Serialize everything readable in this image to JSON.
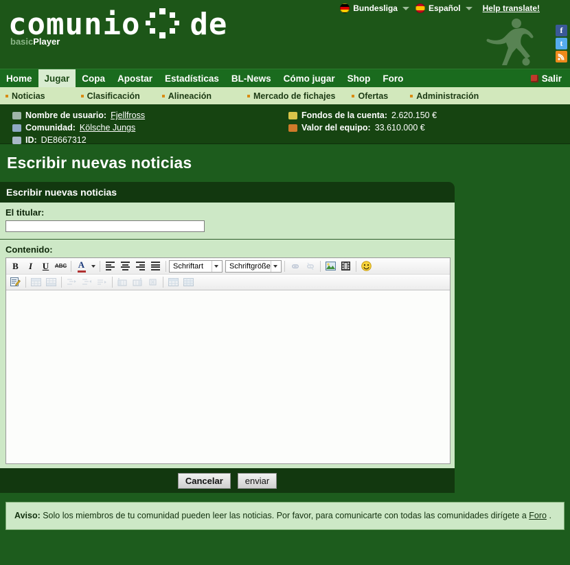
{
  "header": {
    "logo_text": "comunio",
    "logo_text2": "de",
    "sub_basic": "basic",
    "sub_player": "Player",
    "league_label": "Bundesliga",
    "language_label": "Español",
    "help_translate": "Help translate!",
    "social": [
      {
        "name": "facebook-icon",
        "glyph": "f"
      },
      {
        "name": "twitter-icon",
        "glyph": "t"
      },
      {
        "name": "rss-icon",
        "glyph": "◠"
      }
    ]
  },
  "mainnav": {
    "items": [
      {
        "label": "Home",
        "active": false
      },
      {
        "label": "Jugar",
        "active": true
      },
      {
        "label": "Copa",
        "active": false
      },
      {
        "label": "Apostar",
        "active": false
      },
      {
        "label": "Estadísticas",
        "active": false
      },
      {
        "label": "BL-News",
        "active": false
      },
      {
        "label": "Cómo jugar",
        "active": false
      },
      {
        "label": "Shop",
        "active": false
      },
      {
        "label": "Foro",
        "active": false
      }
    ],
    "logout_label": "Salir"
  },
  "subnav": {
    "items": [
      {
        "label": "Noticias"
      },
      {
        "label": "Clasificación"
      },
      {
        "label": "Alineación"
      },
      {
        "label": "Mercado de fichajes"
      },
      {
        "label": "Ofertas"
      },
      {
        "label": "Administración"
      }
    ]
  },
  "userinfo": {
    "username_label": "Nombre de usuario:",
    "username_value": "Fjellfross",
    "community_label": "Comunidad:",
    "community_value": "Kölsche Jungs",
    "id_label": "ID:",
    "id_value": "DE8667312",
    "funds_label": "Fondos de la cuenta:",
    "funds_value": "2.620.150 €",
    "team_value_label": "Valor del equipo:",
    "team_value_value": "33.610.000 €"
  },
  "page": {
    "title": "Escribir nuevas noticias",
    "panel_header": "Escribir nuevas noticias",
    "headline_label": "El titular:",
    "headline_value": "",
    "headline_placeholder": "",
    "content_label": "Contenido:",
    "content_value": ""
  },
  "editor": {
    "font_family_label": "Schriftart",
    "font_size_label": "Schriftgröße",
    "row1": [
      {
        "name": "bold-icon",
        "glyph": "B",
        "disabled": false
      },
      {
        "name": "italic-icon",
        "glyph": "I",
        "disabled": false
      },
      {
        "name": "underline-icon",
        "glyph": "U",
        "disabled": false
      },
      {
        "name": "strikethrough-icon",
        "glyph": "ABC",
        "disabled": false
      },
      {
        "name": "font-color-icon",
        "glyph": "A",
        "disabled": false
      },
      {
        "name": "font-color-dropdown-icon",
        "glyph": "▾",
        "disabled": false
      },
      {
        "name": "align-left-icon",
        "glyph": "",
        "disabled": false
      },
      {
        "name": "align-center-icon",
        "glyph": "",
        "disabled": false
      },
      {
        "name": "align-right-icon",
        "glyph": "",
        "disabled": false
      },
      {
        "name": "align-justify-icon",
        "glyph": "",
        "disabled": false
      },
      {
        "name": "insert-link-icon",
        "glyph": "🔗",
        "disabled": true
      },
      {
        "name": "unlink-icon",
        "glyph": "🔗",
        "disabled": true
      },
      {
        "name": "insert-image-icon",
        "glyph": "🖼",
        "disabled": false
      },
      {
        "name": "insert-media-icon",
        "glyph": "🎞",
        "disabled": false
      },
      {
        "name": "insert-smiley-icon",
        "glyph": "☺",
        "disabled": false
      }
    ],
    "row2": [
      {
        "name": "edit-source-icon",
        "glyph": "✎",
        "disabled": false
      },
      {
        "name": "insert-row-before-icon",
        "glyph": "▤",
        "disabled": true
      },
      {
        "name": "insert-row-after-icon",
        "glyph": "▥",
        "disabled": true
      },
      {
        "name": "indent-increase-icon",
        "glyph": "⇥",
        "disabled": true
      },
      {
        "name": "indent-decrease-icon",
        "glyph": "⇤",
        "disabled": true
      },
      {
        "name": "outdent-icon",
        "glyph": "⇢",
        "disabled": true
      },
      {
        "name": "insert-column-before-icon",
        "glyph": "⫴",
        "disabled": true
      },
      {
        "name": "insert-column-after-icon",
        "glyph": "⫼",
        "disabled": true
      },
      {
        "name": "delete-column-icon",
        "glyph": "⩚",
        "disabled": true
      },
      {
        "name": "insert-table-icon",
        "glyph": "▦",
        "disabled": true
      },
      {
        "name": "table-properties-icon",
        "glyph": "▩",
        "disabled": true
      }
    ]
  },
  "buttons": {
    "cancel_label": "Cancelar",
    "submit_label": "enviar"
  },
  "notice": {
    "prefix": "Aviso:",
    "text_before": " Solo los miembros de tu comunidad pueden leer las noticias. Por favor, para comunicarte con todas las comunidades dirígete a ",
    "link": "Foro",
    "text_after": " ."
  },
  "colors": {
    "background": "#1d5c1d",
    "panel_header": "#12380f",
    "panel_body": "#cde8c6",
    "subnav": "#d2e8bc",
    "nav": "#1a6b1e",
    "accent_orange": "#d98b12"
  }
}
